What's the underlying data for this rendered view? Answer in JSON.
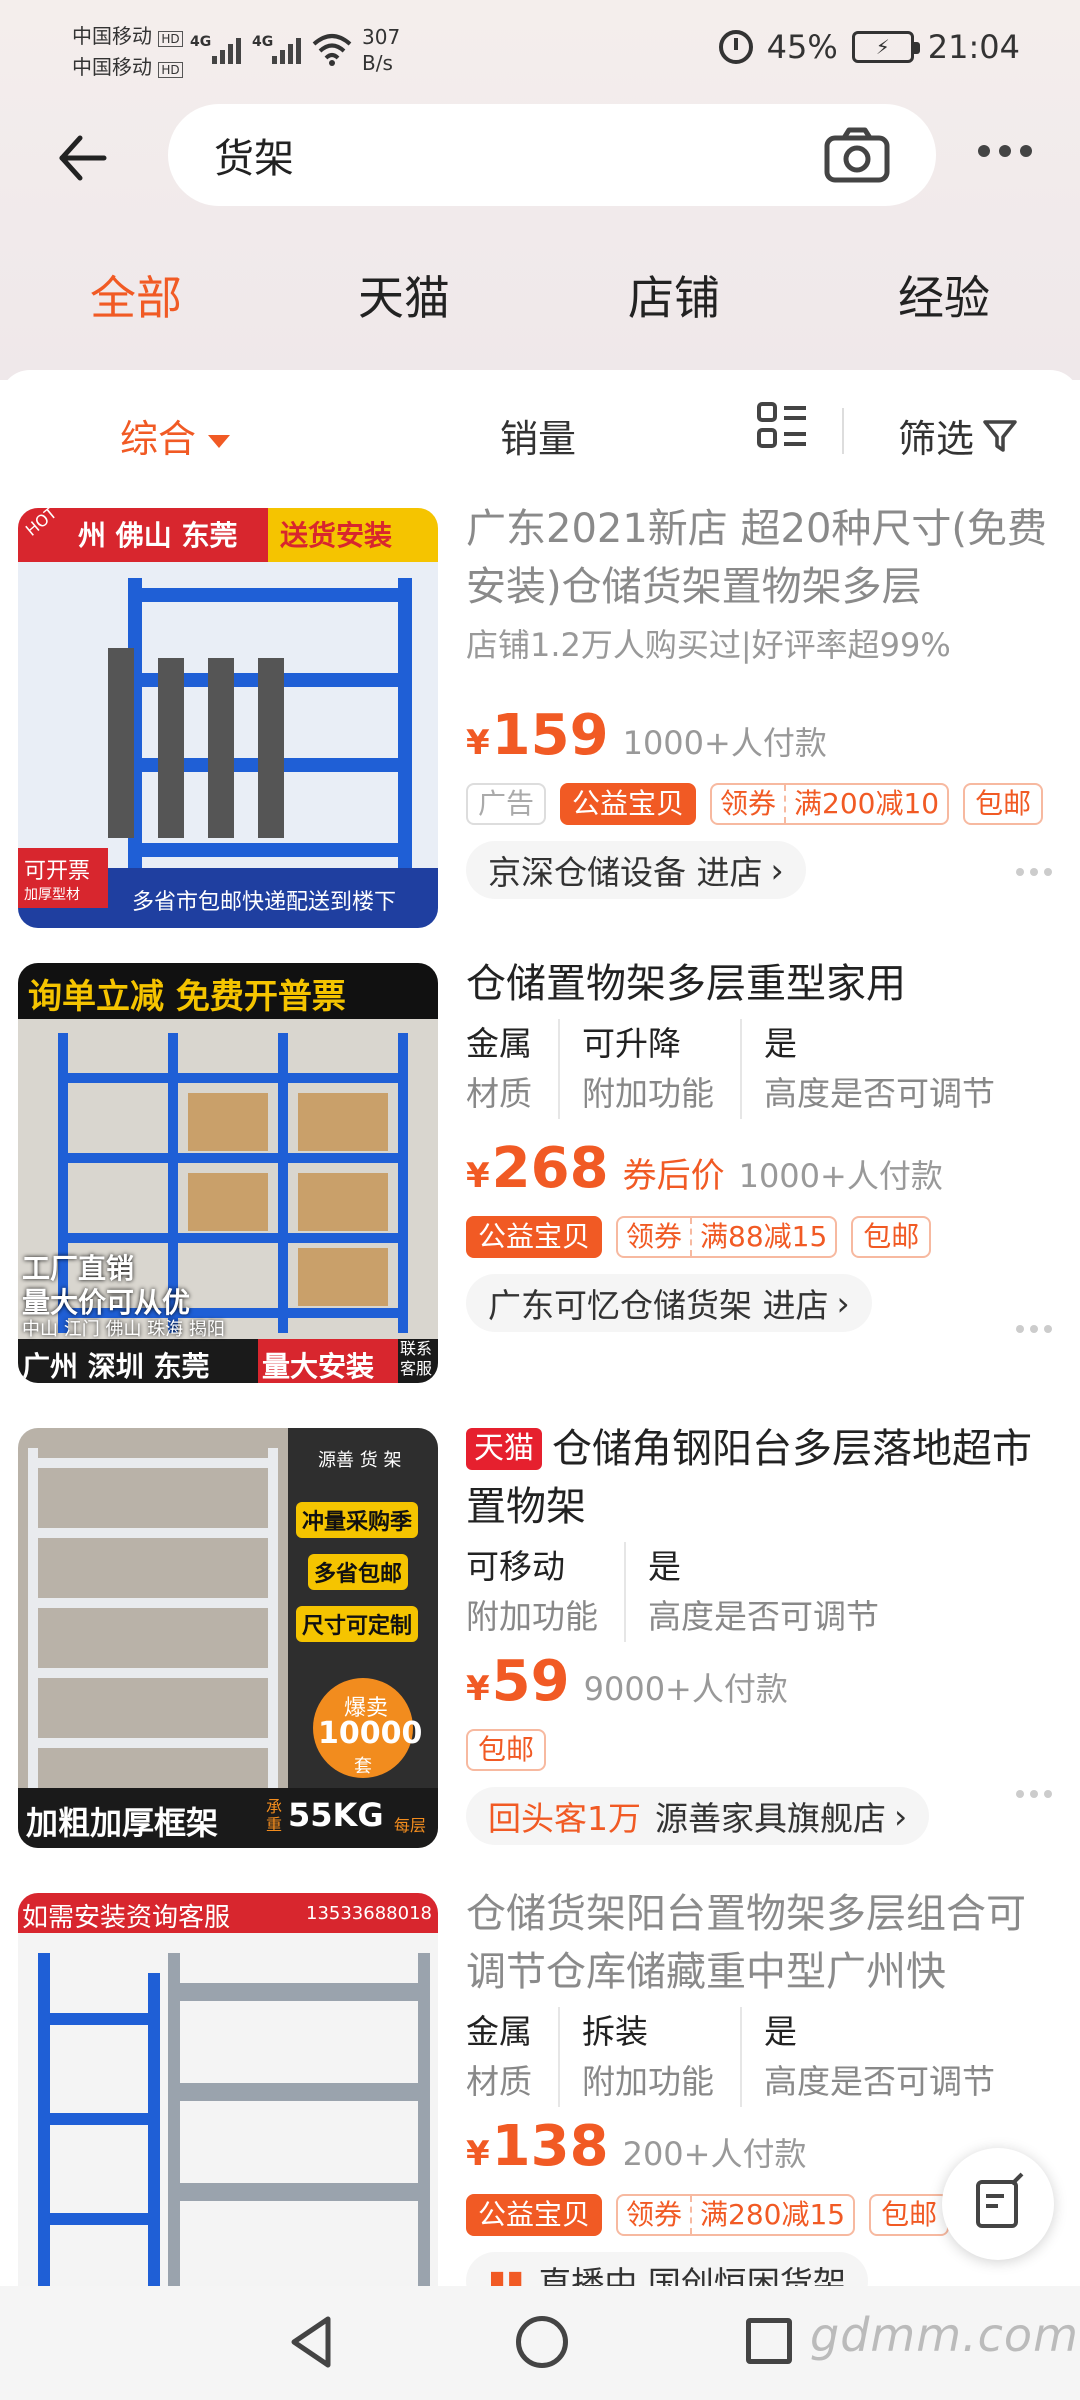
{
  "status": {
    "carrier1": "中国移动",
    "carrier2": "中国移动",
    "sig_label": "4G",
    "net_speed": "307",
    "net_unit": "B/s",
    "battery": "45%",
    "time": "21:04",
    "hd": "HD"
  },
  "search": {
    "query": "货架"
  },
  "tabs": [
    "全部",
    "天猫",
    "店铺",
    "经验"
  ],
  "sortbar": {
    "composite": "综合",
    "sales": "销量",
    "filter": "筛选"
  },
  "products": [
    {
      "title": "广东2021新店 超20种尺寸(免费安装)仓储货架置物架多层",
      "sub": "店铺1.2万人购买过|好评率超99%",
      "price": "159",
      "yen": "¥",
      "sold": "1000+人付款",
      "tags": [
        "广告",
        "公益宝贝"
      ],
      "coupon": [
        "领券",
        "满200减10"
      ],
      "ship": "包邮",
      "shop": "京深仓储设备 进店",
      "thumb": {
        "top_left": "州 佛山 东莞",
        "top_right": "送货安装",
        "hot": "HOT",
        "badge1": "可开票",
        "badge2": "加厚型材",
        "bottom": "多省市包邮快递配送到楼下"
      }
    },
    {
      "title": "仓储置物架多层重型家用",
      "props": [
        {
          "v": "金属",
          "k": "材质"
        },
        {
          "v": "可升降",
          "k": "附加功能"
        },
        {
          "v": "是",
          "k": "高度是否可调节"
        }
      ],
      "price": "268",
      "yen": "¥",
      "after": "券后价",
      "sold": "1000+人付款",
      "tags": [
        "公益宝贝"
      ],
      "coupon": [
        "领券",
        "满88减15"
      ],
      "ship": "包邮",
      "shop": "广东可忆仓储货架 进店",
      "thumb": {
        "top": "询单立减 免费开普票",
        "l1": "工厂直销",
        "l2": "量大价可从优",
        "l3": "中山 江门 佛山 珠海 揭阳",
        "bottom_l": "广州 深圳 东莞",
        "bottom_r": "量大安装",
        "side": "联系客服"
      }
    },
    {
      "tmall": "天猫",
      "title": "仓储角钢阳台多层落地超市置物架",
      "props": [
        {
          "v": "可移动",
          "k": "附加功能"
        },
        {
          "v": "是",
          "k": "高度是否可调节"
        }
      ],
      "price": "59",
      "yen": "¥",
      "sold": "9000+人付款",
      "ship": "包邮",
      "returning": "回头客1万",
      "shop": "源善家具旗舰店",
      "thumb": {
        "brand": "源善 货 架",
        "b1": "冲量采购季",
        "b2": "多省包邮",
        "b3": "尺寸可定制",
        "hot": "爆卖",
        "num": "10000",
        "unit": "套",
        "bottom": "加粗加厚框架",
        "load": "承重",
        "kg": "55KG",
        "per": "每层"
      }
    },
    {
      "title": "仓储货架阳台置物架多层组合可调节仓库储藏重中型广州快",
      "props": [
        {
          "v": "金属",
          "k": "材质"
        },
        {
          "v": "拆装",
          "k": "附加功能"
        },
        {
          "v": "是",
          "k": "高度是否可调节"
        }
      ],
      "price": "138",
      "yen": "¥",
      "sold": "200+人付款",
      "tags": [
        "公益宝贝"
      ],
      "coupon": [
        "领券",
        "满280减15"
      ],
      "ship": "包邮",
      "shop": "直播中 国创恒困货架",
      "thumb": {
        "top": "如需安装资询客服",
        "phone": "13533688018"
      }
    }
  ],
  "watermark": "gdmm.com",
  "colors": {
    "accent": "#f15a24",
    "tmall": "#e6202e",
    "shelf_blue": "#1f5fd6"
  }
}
